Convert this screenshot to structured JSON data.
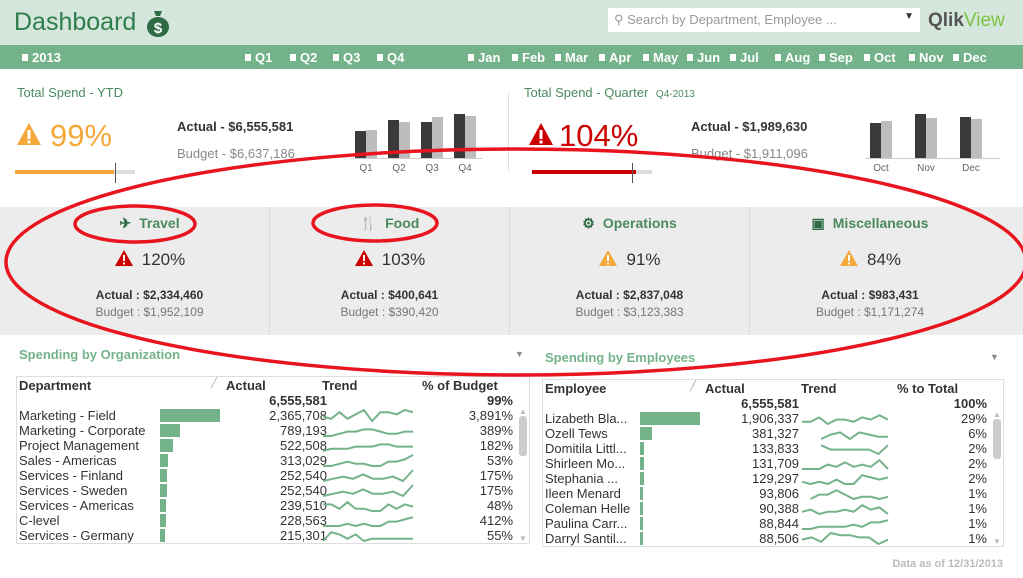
{
  "header": {
    "title": "Dashboard",
    "search_placeholder": "Search by Department, Employee ...",
    "logo_a": "Qlik",
    "logo_b": "View"
  },
  "nav": {
    "year": "2013",
    "quarters": [
      "Q1",
      "Q2",
      "Q3",
      "Q4"
    ],
    "months": [
      "Jan",
      "Feb",
      "Mar",
      "Apr",
      "May",
      "Jun",
      "Jul",
      "Aug",
      "Sep",
      "Oct",
      "Nov",
      "Dec"
    ]
  },
  "ytd": {
    "title": "Total Spend - YTD",
    "pct": "99%",
    "actual": "Actual - $6,555,581",
    "budget": "Budget - $6,637,186",
    "progress": 0.99,
    "color": "#f5a83a",
    "chart": {
      "categories": [
        "Q1",
        "Q2",
        "Q3",
        "Q4"
      ],
      "actual": [
        27,
        38,
        36,
        44
      ],
      "budget": [
        28,
        36,
        41,
        42
      ]
    }
  },
  "qtr": {
    "title": "Total Spend - Quarter",
    "sub": "Q4-2013",
    "pct": "104%",
    "actual": "Actual - $1,989,630",
    "budget": "Budget - $1,911,096",
    "progress": 1.04,
    "color": "#c00",
    "chart": {
      "categories": [
        "Oct",
        "Nov",
        "Dec"
      ],
      "actual": [
        35,
        44,
        41
      ],
      "budget": [
        37,
        40,
        39
      ]
    }
  },
  "categories": [
    {
      "name": "Travel",
      "pct": "120%",
      "actual": "Actual : $2,334,460",
      "budget": "Budget : $1,952,109",
      "status": "red"
    },
    {
      "name": "Food",
      "pct": "103%",
      "actual": "Actual : $400,641",
      "budget": "Budget : $390,420",
      "status": "red"
    },
    {
      "name": "Operations",
      "pct": "91%",
      "actual": "Actual : $2,837,048",
      "budget": "Budget : $3,123,383",
      "status": "orange"
    },
    {
      "name": "Miscellaneous",
      "pct": "84%",
      "actual": "Actual : $983,431",
      "budget": "Budget : $1,171,274",
      "status": "orange",
      "icon_text": "Misc"
    }
  ],
  "org": {
    "title": "Spending by Organization",
    "cols": [
      "Department",
      "Actual",
      "Trend",
      "% of Budget"
    ],
    "total": "6,555,581",
    "total_pct": "99%",
    "rows": [
      {
        "name": "Marketing - Field",
        "actual": "2,365,708",
        "pct": "3,891%",
        "frac": 1,
        "trend": [
          3,
          2,
          5,
          2,
          4,
          6,
          1,
          5,
          5,
          4,
          6,
          5
        ]
      },
      {
        "name": "Marketing - Corporate",
        "actual": "789,193",
        "pct": "389%",
        "frac": 0.33,
        "trend": [
          1,
          1,
          2,
          3,
          3,
          4,
          4,
          3,
          2,
          2,
          3,
          3
        ]
      },
      {
        "name": "Project Management",
        "actual": "522,508",
        "pct": "182%",
        "frac": 0.22,
        "trend": [
          1,
          2,
          2,
          2,
          3,
          3,
          3,
          4,
          4,
          3,
          3,
          3
        ]
      },
      {
        "name": "Sales - Americas",
        "actual": "313,029",
        "pct": "53%",
        "frac": 0.13,
        "trend": [
          1,
          1,
          2,
          3,
          2,
          2,
          1,
          1,
          3,
          3,
          4,
          6
        ]
      },
      {
        "name": "Services - Finland",
        "actual": "252,540",
        "pct": "175%",
        "frac": 0.11,
        "trend": [
          1,
          2,
          3,
          2,
          4,
          2,
          2,
          3,
          1,
          6
        ]
      },
      {
        "name": "Services - Sweden",
        "actual": "252,540",
        "pct": "175%",
        "frac": 0.11,
        "trend": [
          1,
          2,
          3,
          2,
          4,
          2,
          2,
          3,
          1,
          6
        ]
      },
      {
        "name": "Services - Americas",
        "actual": "239,510",
        "pct": "48%",
        "frac": 0.1,
        "trend": [
          4,
          4,
          2,
          5,
          2,
          2,
          1,
          1,
          4,
          2,
          4,
          3
        ]
      },
      {
        "name": "C-level",
        "actual": "228,563",
        "pct": "412%",
        "frac": 0.1,
        "trend": [
          1,
          1,
          1,
          2,
          1,
          2,
          1,
          1,
          3,
          3,
          4,
          5
        ]
      },
      {
        "name": "Services - Germany",
        "actual": "215,301",
        "pct": "55%",
        "frac": 0.09,
        "trend": [
          1,
          5,
          4,
          2,
          4,
          1,
          2,
          2,
          2,
          2,
          2,
          2
        ]
      }
    ]
  },
  "emp": {
    "title": "Spending by Employees",
    "cols": [
      "Employee",
      "Actual",
      "Trend",
      "% to Total"
    ],
    "total": "6,555,581",
    "total_pct": "100%",
    "rows": [
      {
        "name": "Lizabeth  Bla...",
        "actual": "1,906,337",
        "pct": "29%",
        "frac": 1,
        "trend": [
          2,
          2,
          4,
          1,
          3,
          3,
          2,
          4,
          3,
          5,
          3
        ]
      },
      {
        "name": "Ozell  Tews",
        "actual": "381,327",
        "pct": "6%",
        "frac": 0.2,
        "trend": [
          null,
          null,
          1,
          3,
          4,
          1,
          4,
          3,
          2,
          2
        ]
      },
      {
        "name": "Domitila  Littl...",
        "actual": "133,833",
        "pct": "2%",
        "frac": 0.07,
        "trend": [
          null,
          null,
          5,
          3,
          3,
          3,
          3,
          3,
          1,
          5
        ]
      },
      {
        "name": "Shirleen  Mo...",
        "actual": "131,709",
        "pct": "2%",
        "frac": 0.07,
        "trend": [
          1,
          1,
          1,
          3,
          2,
          4,
          2,
          3,
          2,
          5,
          1
        ]
      },
      {
        "name": "Stephania  ...",
        "actual": "129,297",
        "pct": "2%",
        "frac": 0.07,
        "trend": [
          2,
          1,
          2,
          1,
          3,
          1,
          1,
          5,
          4,
          3,
          4
        ]
      },
      {
        "name": "Ileen  Menard",
        "actual": "93,806",
        "pct": "1%",
        "frac": 0.05,
        "trend": [
          null,
          1,
          3,
          3,
          5,
          3,
          1,
          2,
          2,
          1,
          2
        ]
      },
      {
        "name": "Coleman  Helle",
        "actual": "90,388",
        "pct": "1%",
        "frac": 0.05,
        "trend": [
          2,
          3,
          1,
          2,
          2,
          3,
          2,
          5,
          3,
          4,
          1
        ]
      },
      {
        "name": "Paulina  Carr...",
        "actual": "88,844",
        "pct": "1%",
        "frac": 0.05,
        "trend": [
          1,
          1,
          2,
          2,
          2,
          2,
          3,
          2,
          4,
          4,
          5
        ]
      },
      {
        "name": "Darryl  Santil...",
        "actual": "88,506",
        "pct": "1%",
        "frac": 0.05,
        "trend": [
          3,
          4,
          2,
          6,
          5,
          5,
          4,
          4,
          1,
          3
        ]
      }
    ]
  },
  "footer": {
    "as_of": "Data as of 12/31/2013"
  }
}
